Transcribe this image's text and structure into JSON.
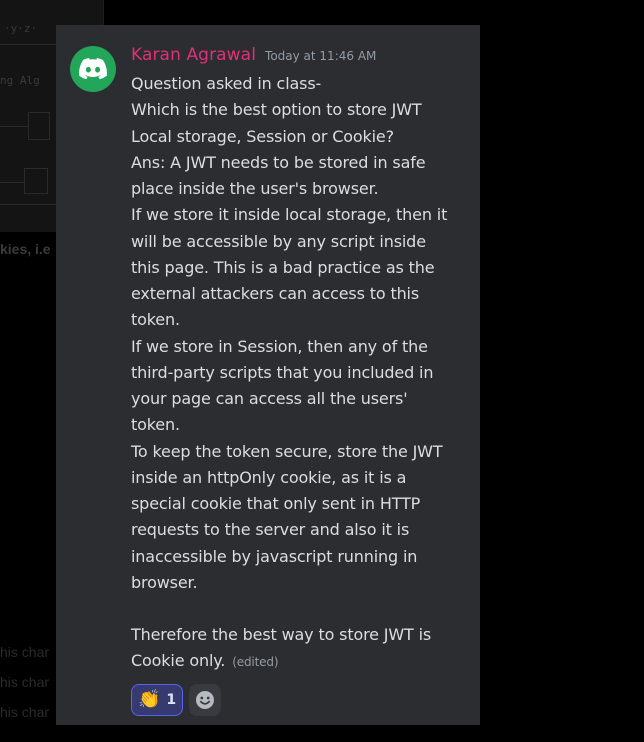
{
  "message": {
    "author": "Karan Agrawal",
    "timestamp": "Today at 11:46 AM",
    "lines": [
      "Question asked in class-",
      "Which is the best option to store JWT",
      "Local storage, Session or Cookie?",
      "Ans: A JWT needs to be stored in safe",
      "place inside the user's browser.",
      "If we store it inside local storage, then it",
      "will be accessible by any script inside",
      "this page. This is a bad practice as the",
      "external attackers can access to this",
      "token.",
      "If we store in Session, then any of the",
      "third-party scripts that you included in",
      "your page can access all the users'",
      "token.",
      "To keep the token secure, store the JWT",
      "inside an httpOnly cookie, as it is a",
      "special cookie that only sent in HTTP",
      "requests to the server and also it is",
      "inaccessible by javascript running in",
      "browser.",
      "",
      "Therefore the best way to store JWT is",
      "Cookie only."
    ],
    "edited_label": "(edited)",
    "reactions": [
      {
        "emoji": "👏",
        "count": "1",
        "icon": "clapping-hands-icon"
      }
    ],
    "add_reaction_icon": "smiley-add-reaction-icon"
  },
  "background": {
    "thumb_text_1": "·y·z·",
    "thumb_text_2": "ng  Alg",
    "side_text": "kies, i.e",
    "side_fragment": "his char"
  },
  "colors": {
    "card": "#2b2d31",
    "username": "#e0307a",
    "avatar": "#23a55a",
    "text": "#dbdee1",
    "muted": "#949ba4",
    "reaction_bg": "#373a6e",
    "reaction_border": "#5865f2"
  }
}
